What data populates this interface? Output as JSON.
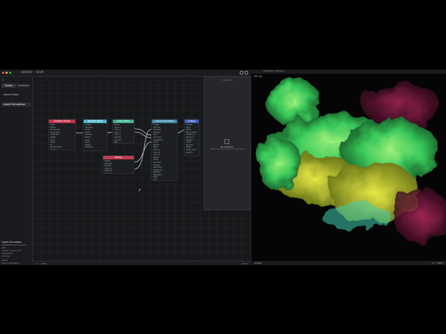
{
  "window": {
    "title": "Untitled — Draft",
    "preview_title": "Realtime Preview"
  },
  "sidebar": {
    "search_placeholder": "Q",
    "tabs": [
      "Nodes",
      "Variables"
    ],
    "items": [
      {
        "label": "Liquid Glass",
        "selected": false
      },
      {
        "label": "Liquid Simulation",
        "selected": true
      }
    ],
    "info_title": "Liquid Simulation",
    "info_lines": [
      "Simulate fluid dynamics with",
      "custom colors and interactive",
      "controls."
    ],
    "footer_items": [
      "Liquid",
      "Liquid Simulation"
    ]
  },
  "overlay": {
    "title": "Inspector",
    "message": "No selection",
    "sub": "Select a node to inspect its properties"
  },
  "nodes": [
    {
      "id": "n1",
      "title": "Gradient Noise",
      "color": "#c2344a",
      "rows": [
        "Scale",
        "Detail",
        "Roughness",
        "Lacunarity",
        "Distortion",
        "Offset",
        "Time",
        "Seed",
        "W",
        "Randomness",
        "Output"
      ]
    },
    {
      "id": "n2",
      "title": "Domain Warp",
      "color": "#4fb6c8",
      "rows": [
        "Image",
        "Strength",
        "Scale",
        "Detail",
        "Octaves",
        "Falloff",
        "Time",
        "Seed",
        "Speed",
        "Direction"
      ]
    },
    {
      "id": "n3",
      "title": "Color Ramp",
      "color": "#3fae8a",
      "rows": [
        "Factor",
        "Color 1",
        "Color 2",
        "Color 3",
        "Color 4",
        "Position",
        "Smooth",
        "Bias",
        "Clamp"
      ]
    },
    {
      "id": "n4",
      "title": "Bump",
      "color": "#c33b55",
      "rows": [
        "Height",
        "Strength",
        "Normal",
        "Light Dir",
        "Ambient",
        "Specular"
      ]
    },
    {
      "id": "n5",
      "title": "Liquid Simulation",
      "color": "#3f8aa8",
      "rows": [
        "Image",
        "Velocity",
        "Pressure",
        "Density",
        "Curl",
        "Viscosity",
        "Dissipation",
        "Force",
        "Radius",
        "Splat",
        "Color A",
        "Color B",
        "Color C",
        "Bloom",
        "Gloss",
        "Specular",
        "Fresnel",
        "Refraction",
        "Dispersion",
        "Shadow",
        "Highlight",
        "Edge",
        "Tint",
        "Iterations",
        "Resolution",
        "Sunrays",
        "Output"
      ]
    },
    {
      "id": "n6",
      "title": "Output",
      "color": "#3d5fb8",
      "rows": [
        "Shader",
        "Color",
        "Alpha",
        "Blend Mode",
        "Position X",
        "Position Y",
        "Rotation",
        "Scale",
        "Opacity",
        "Depth",
        "Depth Test",
        "Post FX"
      ]
    }
  ],
  "status": {
    "left": "1:1 · 100%",
    "right": "Zoom"
  },
  "preview": {
    "fps": "FPS: 60",
    "footer_left": "Shader",
    "footer_right": "1:1 · 100%"
  },
  "colors": {
    "accent_green": "#47d36b",
    "accent_pink": "#c3246a",
    "accent_yellow": "#c8c82a"
  }
}
